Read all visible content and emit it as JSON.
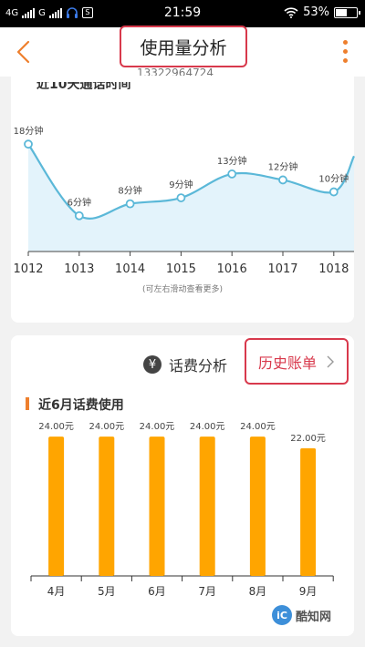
{
  "status_bar": {
    "network_1": "4G",
    "network_2": "G",
    "time": "21:59",
    "battery": "53%",
    "battery_level": 0.53,
    "icons": [
      "signal-icon",
      "signal-icon",
      "headset-icon",
      "notification-icon",
      "wifi-icon",
      "battery-icon"
    ]
  },
  "header": {
    "title": "使用量分析",
    "subtitle": "13322964724",
    "back_icon": "chevron-left-icon",
    "menu_icon": "more-vertical-icon",
    "accent": "#ee7f2d"
  },
  "usage_card": {
    "title": "近10天通话时间",
    "scroll_hint": "(可左右滑动查看更多)"
  },
  "fee_card": {
    "title": "话费分析",
    "history_button": "历史账单",
    "section_title": "近6月话费使用"
  },
  "watermark": {
    "logo": "iC",
    "text": "酷知网"
  },
  "chart_data": [
    {
      "type": "area",
      "title": "近10天通话时间",
      "categories": [
        "1012",
        "1013",
        "1014",
        "1015",
        "1016",
        "1017",
        "1018"
      ],
      "values": [
        18,
        6,
        8,
        9,
        13,
        12,
        10
      ],
      "data_labels": [
        "18分钟",
        "6分钟",
        "8分钟",
        "9分钟",
        "13分钟",
        "12分钟",
        "10分钟"
      ],
      "y_min": 0,
      "y_max": 22,
      "line_color": "#5bb8d8",
      "fill_color": "#e3f3fb"
    },
    {
      "type": "bar",
      "title": "近6月话费使用",
      "categories": [
        "4月",
        "5月",
        "6月",
        "7月",
        "8月",
        "9月"
      ],
      "values": [
        24.0,
        24.0,
        24.0,
        24.0,
        24.0,
        22.0
      ],
      "data_labels": [
        "24.00元",
        "24.00元",
        "24.00元",
        "24.00元",
        "24.00元",
        "22.00元"
      ],
      "y_min": 0,
      "y_max": 27,
      "bar_color": "#ffa500"
    }
  ]
}
